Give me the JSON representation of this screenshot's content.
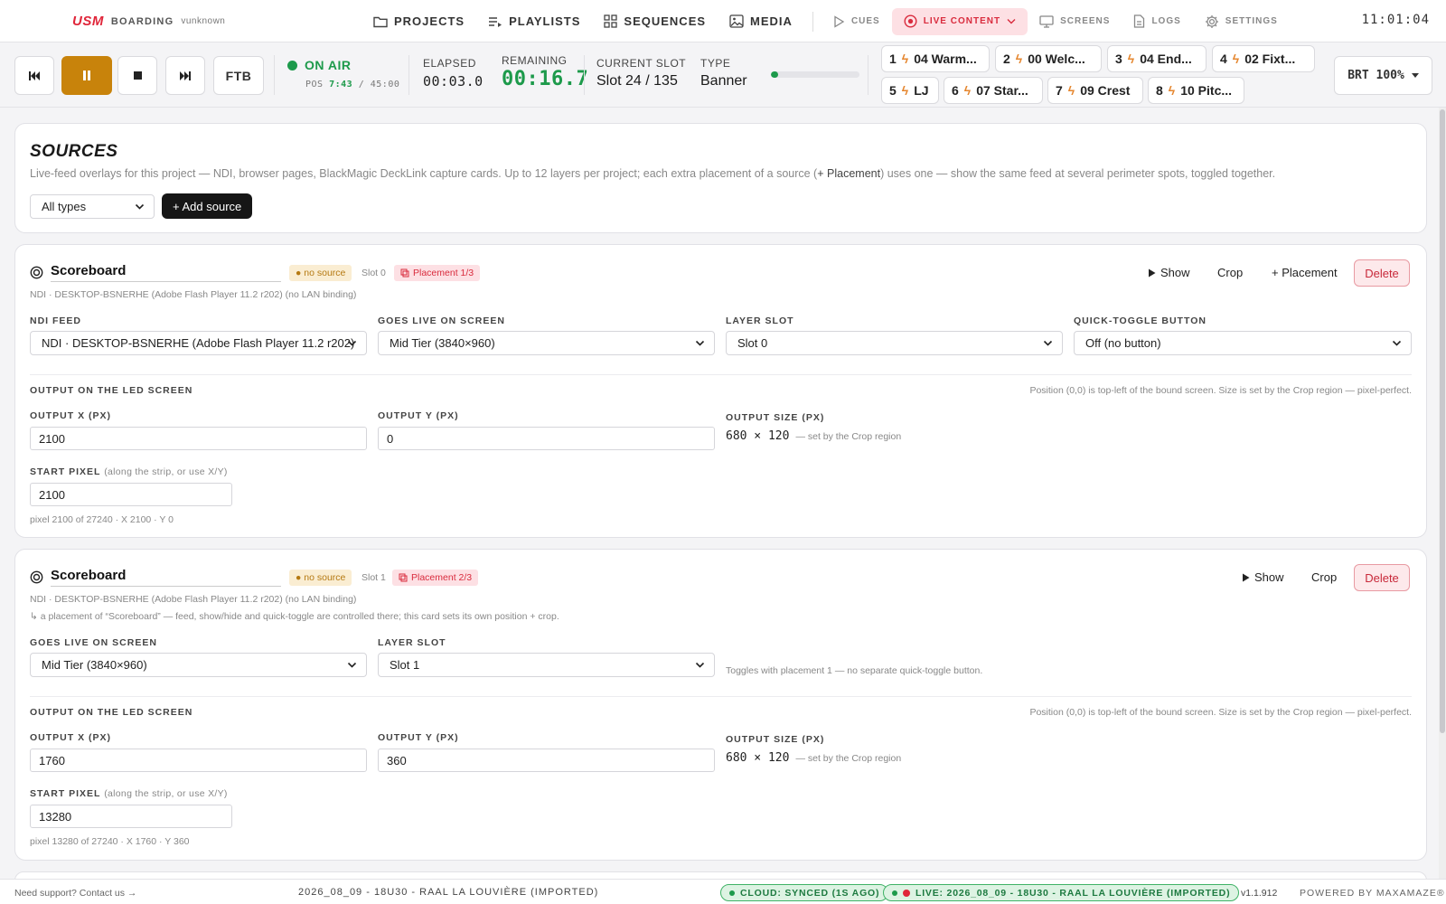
{
  "brand": {
    "logo": "USM",
    "section": "BOARDING",
    "user": "vunknown"
  },
  "nav": {
    "main": [
      {
        "label": "PROJECTS",
        "icon": "folder-icon"
      },
      {
        "label": "PLAYLISTS",
        "icon": "playlist-icon"
      },
      {
        "label": "SEQUENCES",
        "icon": "grid-icon"
      },
      {
        "label": "MEDIA",
        "icon": "image-icon"
      }
    ],
    "secondary": [
      {
        "label": "CUES",
        "icon": "play-outline-icon"
      },
      {
        "label": "LIVE CONTENT",
        "icon": "broadcast-icon",
        "active": true
      },
      {
        "label": "SCREENS",
        "icon": "monitor-icon"
      },
      {
        "label": "LOGS",
        "icon": "document-icon"
      },
      {
        "label": "SETTINGS",
        "icon": "gear-icon"
      }
    ],
    "clock": "11:01:04"
  },
  "transport": {
    "ftb": "FTB",
    "status": "ON AIR",
    "pos_label": "POS",
    "pos_current": "7:43",
    "pos_total": "/ 45:00",
    "elapsed_label": "ELAPSED",
    "elapsed": "00:03.0",
    "remaining_label": "REMAINING",
    "remaining": "00:16.7",
    "slot_label": "CURRENT SLOT",
    "slot": "Slot 24 / 135",
    "type_label": "TYPE",
    "type": "Banner",
    "progress": 0.08,
    "brt": "BRT 100%"
  },
  "cues": [
    {
      "num": "1",
      "name": "04 Warm..."
    },
    {
      "num": "2",
      "name": "00 Welc..."
    },
    {
      "num": "3",
      "name": "04 End..."
    },
    {
      "num": "4",
      "name": "02 Fixt..."
    },
    {
      "num": "5",
      "name": "LJ"
    },
    {
      "num": "6",
      "name": "07 Star..."
    },
    {
      "num": "7",
      "name": "09 Crest"
    },
    {
      "num": "8",
      "name": "10 Pitc..."
    }
  ],
  "sources": {
    "title": "SOURCES",
    "desc_pre": "Live-feed overlays for this project — NDI, browser pages, BlackMagic DeckLink capture cards. Up to 12 layers per project; each extra placement of a source (",
    "desc_bold": "+ Placement",
    "desc_post": ") uses one — show the same feed at several perimeter spots, toggled together.",
    "filter": "All types",
    "add": "+ Add source"
  },
  "cards": [
    {
      "name": "Scoreboard",
      "badge": "● no source",
      "slot_tag": "Slot 0",
      "placement": "Placement 1/3",
      "show": "Show",
      "crop": "Crop",
      "add_placement": "+ Placement",
      "delete": "Delete",
      "subline": "NDI · DESKTOP-BSNERHE (Adobe Flash Player 11.2 r202) (no LAN binding)",
      "ndi_label": "NDI FEED",
      "ndi_value": "NDI · DESKTOP-BSNERHE (Adobe Flash Player 11.2 r202)",
      "screen_label": "GOES LIVE ON SCREEN",
      "screen_value": "Mid Tier (3840×960)",
      "layer_label": "LAYER SLOT",
      "layer_value": "Slot 0",
      "toggle_label": "QUICK-TOGGLE BUTTON",
      "toggle_value": "Off (no button)",
      "output_title": "OUTPUT ON THE LED SCREEN",
      "output_hint": "Position (0,0) is top-left of the bound screen. Size is set by the Crop region — pixel-perfect.",
      "x_label": "OUTPUT X (PX)",
      "x_value": "2100",
      "y_label": "OUTPUT Y (PX)",
      "y_value": "0",
      "size_label": "OUTPUT SIZE (PX)",
      "size_value": "680 × 120",
      "size_note": "— set by the Crop region",
      "start_label": "START PIXEL",
      "start_label_note": "(along the strip, or use X/Y)",
      "start_value": "2100",
      "pixel_note": "pixel 2100 of 27240 · X 2100 · Y 0"
    },
    {
      "name": "Scoreboard",
      "badge": "● no source",
      "slot_tag": "Slot 1",
      "placement": "Placement 2/3",
      "show": "Show",
      "crop": "Crop",
      "delete": "Delete",
      "subline": "NDI · DESKTOP-BSNERHE (Adobe Flash Player 11.2 r202) (no LAN binding)",
      "subline2": "↳ a placement of “Scoreboard” — feed, show/hide and quick-toggle are controlled there; this card sets its own position + crop.",
      "screen_label": "GOES LIVE ON SCREEN",
      "screen_value": "Mid Tier (3840×960)",
      "layer_label": "LAYER SLOT",
      "layer_value": "Slot 1",
      "toggle_note": "Toggles with placement 1 — no separate quick-toggle button.",
      "output_title": "OUTPUT ON THE LED SCREEN",
      "output_hint": "Position (0,0) is top-left of the bound screen. Size is set by the Crop region — pixel-perfect.",
      "x_label": "OUTPUT X (PX)",
      "x_value": "1760",
      "y_label": "OUTPUT Y (PX)",
      "y_value": "360",
      "size_label": "OUTPUT SIZE (PX)",
      "size_value": "680 × 120",
      "size_note": "— set by the Crop region",
      "start_label": "START PIXEL",
      "start_label_note": "(along the strip, or use X/Y)",
      "start_value": "13280",
      "pixel_note": "pixel 13280 of 27240 · X 1760 · Y 360"
    }
  ],
  "footer": {
    "support": "Need support? Contact us →",
    "project": "2026_08_09 - 18U30 - RAAL LA LOUVIÈRE (IMPORTED)",
    "cloud": "CLOUD: SYNCED (1S AGO)",
    "live": "LIVE: 2026_08_09 - 18U30 - RAAL LA LOUVIÈRE (IMPORTED)",
    "version": "v1.1.912",
    "powered": "POWERED BY MAXAMAZE®"
  },
  "colors": {
    "accent": "#e0263a",
    "on_air": "#1d9a4b",
    "pause": "#c8830b",
    "cue_bolt": "#e5862e"
  }
}
